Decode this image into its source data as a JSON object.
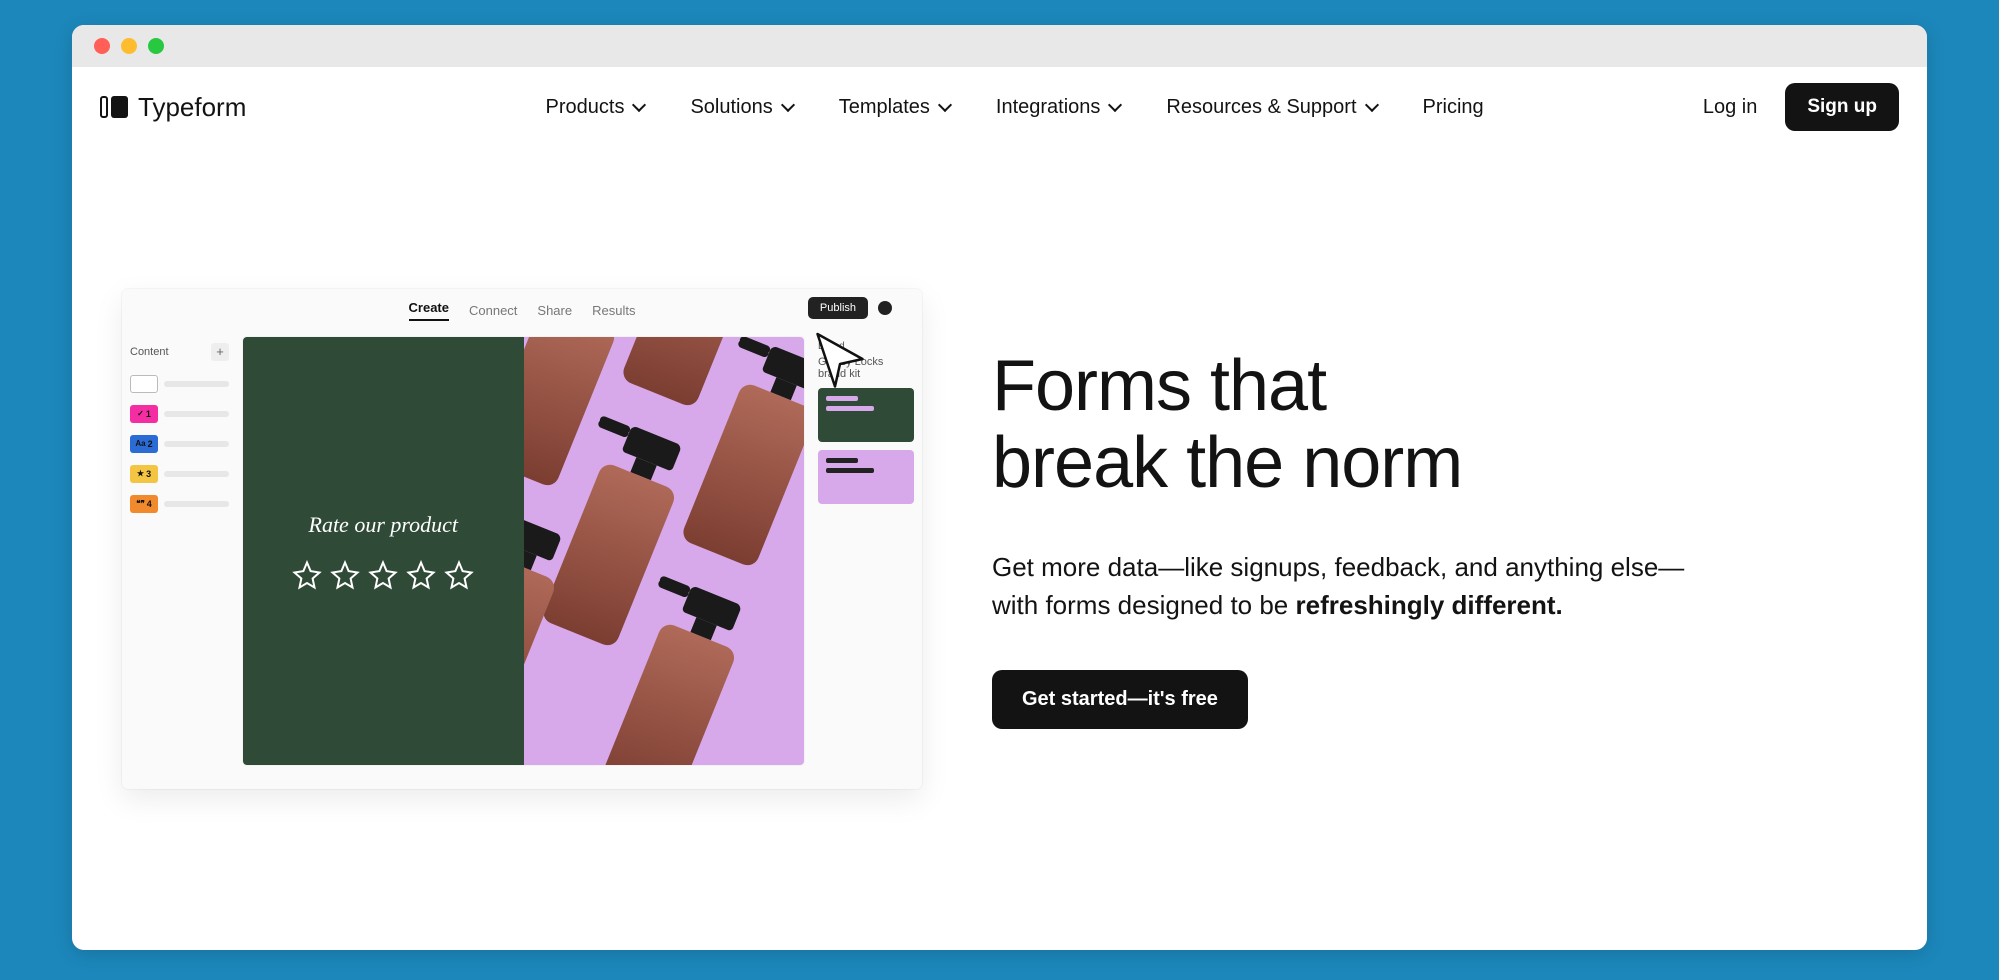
{
  "brand": "Typeform",
  "nav": {
    "products": "Products",
    "solutions": "Solutions",
    "templates": "Templates",
    "integrations": "Integrations",
    "resources": "Resources & Support",
    "pricing": "Pricing",
    "login": "Log in",
    "signup": "Sign up"
  },
  "hero": {
    "headline_l1": "Forms that",
    "headline_l2": "break the norm",
    "sub_pre": "Get more data—like signups, feedback, and anything else—with forms designed to be ",
    "sub_bold": "refreshingly different.",
    "cta": "Get started—it's free"
  },
  "mock": {
    "tabs": {
      "create": "Create",
      "connect": "Connect",
      "share": "Share",
      "results": "Results"
    },
    "publish": "Publish",
    "content_label": "Content",
    "question_prompt": "Rate our product",
    "brand_label": "Brand",
    "brandkit": "Glossy Locks brand kit",
    "q_badges": [
      "",
      "1",
      "2",
      "3",
      "4"
    ],
    "q_colors": [
      "#ffffff",
      "#f42ea2",
      "#2a6bd6",
      "#f4c542",
      "#f08a2c"
    ],
    "q_icons": [
      "",
      "✓",
      "Aa",
      "★",
      "❝❞"
    ]
  }
}
